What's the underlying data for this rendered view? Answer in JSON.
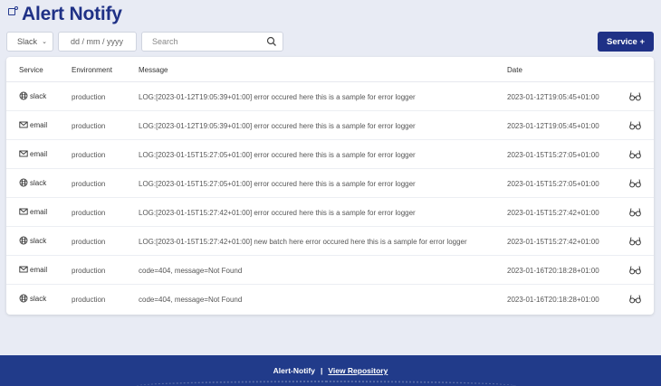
{
  "header": {
    "title": "Alert Notify"
  },
  "filters": {
    "service_select": "Slack",
    "date_placeholder": "dd / mm / yyyy",
    "search_placeholder": "Search"
  },
  "actions": {
    "service_button": "Service +"
  },
  "table": {
    "headers": {
      "service": "Service",
      "environment": "Environment",
      "message": "Message",
      "date": "Date"
    },
    "rows": [
      {
        "service": "slack",
        "icon": "slack-icon",
        "environment": "production",
        "message": "LOG:[2023-01-12T19:05:39+01:00] error occured here this is a sample for error logger",
        "date": "2023-01-12T19:05:45+01:00"
      },
      {
        "service": "email",
        "icon": "email-icon",
        "environment": "production",
        "message": "LOG:[2023-01-12T19:05:39+01:00] error occured here this is a sample for error logger",
        "date": "2023-01-12T19:05:45+01:00"
      },
      {
        "service": "email",
        "icon": "email-icon",
        "environment": "production",
        "message": "LOG:[2023-01-15T15:27:05+01:00] error occured here this is a sample for error logger",
        "date": "2023-01-15T15:27:05+01:00"
      },
      {
        "service": "slack",
        "icon": "slack-icon",
        "environment": "production",
        "message": "LOG:[2023-01-15T15:27:05+01:00] error occured here this is a sample for error logger",
        "date": "2023-01-15T15:27:05+01:00"
      },
      {
        "service": "email",
        "icon": "email-icon",
        "environment": "production",
        "message": "LOG:[2023-01-15T15:27:42+01:00] error occured here this is a sample for error logger",
        "date": "2023-01-15T15:27:42+01:00"
      },
      {
        "service": "slack",
        "icon": "slack-icon",
        "environment": "production",
        "message": "LOG:[2023-01-15T15:27:42+01:00] new batch here error occured here this is a sample for error logger",
        "date": "2023-01-15T15:27:42+01:00"
      },
      {
        "service": "email",
        "icon": "email-icon",
        "environment": "production",
        "message": "code=404, message=Not Found",
        "date": "2023-01-16T20:18:28+01:00"
      },
      {
        "service": "slack",
        "icon": "slack-icon",
        "environment": "production",
        "message": "code=404, message=Not Found",
        "date": "2023-01-16T20:18:28+01:00"
      }
    ]
  },
  "footer": {
    "brand": "Alert-Notify",
    "separator": "|",
    "link": "View Repository"
  },
  "colors": {
    "brand": "#1f3186",
    "footer_bg": "#213b8a",
    "page_bg": "#e8ebf4"
  }
}
